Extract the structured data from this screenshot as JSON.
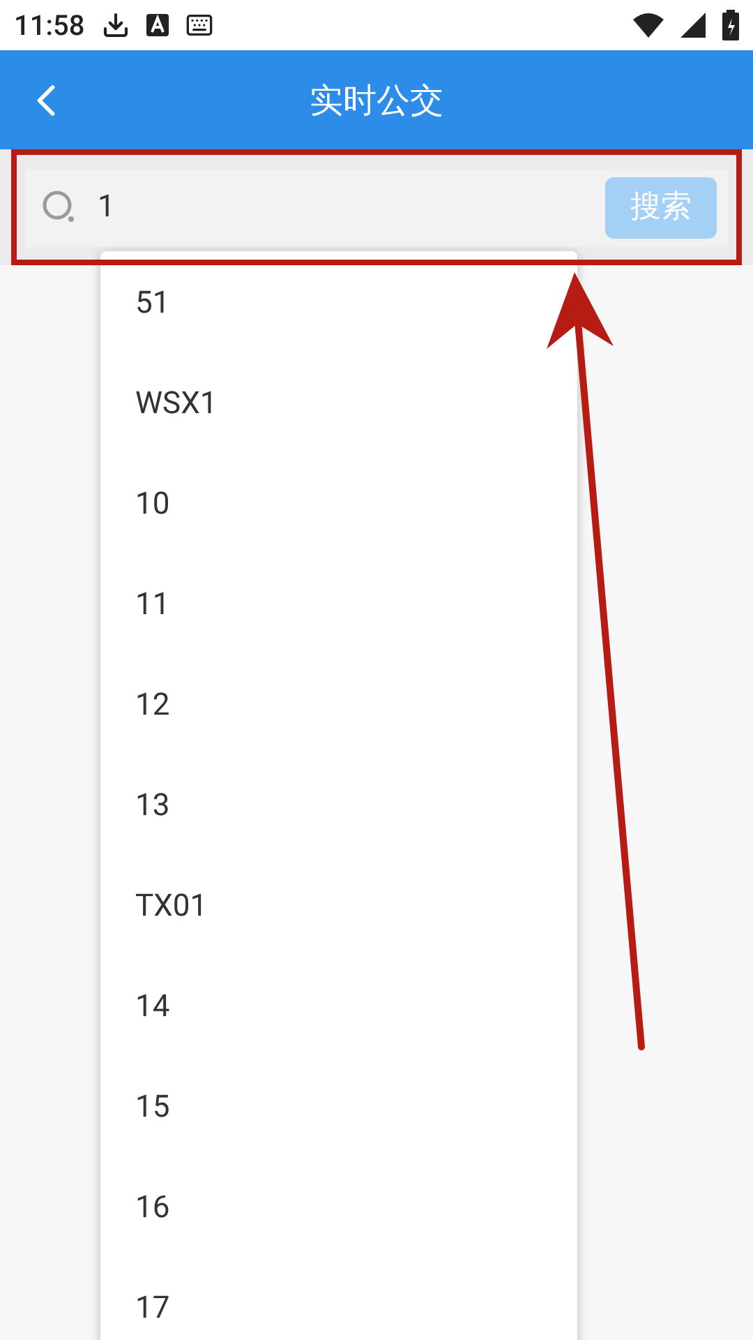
{
  "status_bar": {
    "time": "11:58"
  },
  "header": {
    "title": "实时公交"
  },
  "search": {
    "value": "1",
    "button": "搜索"
  },
  "suggestions": [
    "51",
    "WSX1",
    "10",
    "11",
    "12",
    "13",
    "TX01",
    "14",
    "15",
    "16",
    "17"
  ]
}
